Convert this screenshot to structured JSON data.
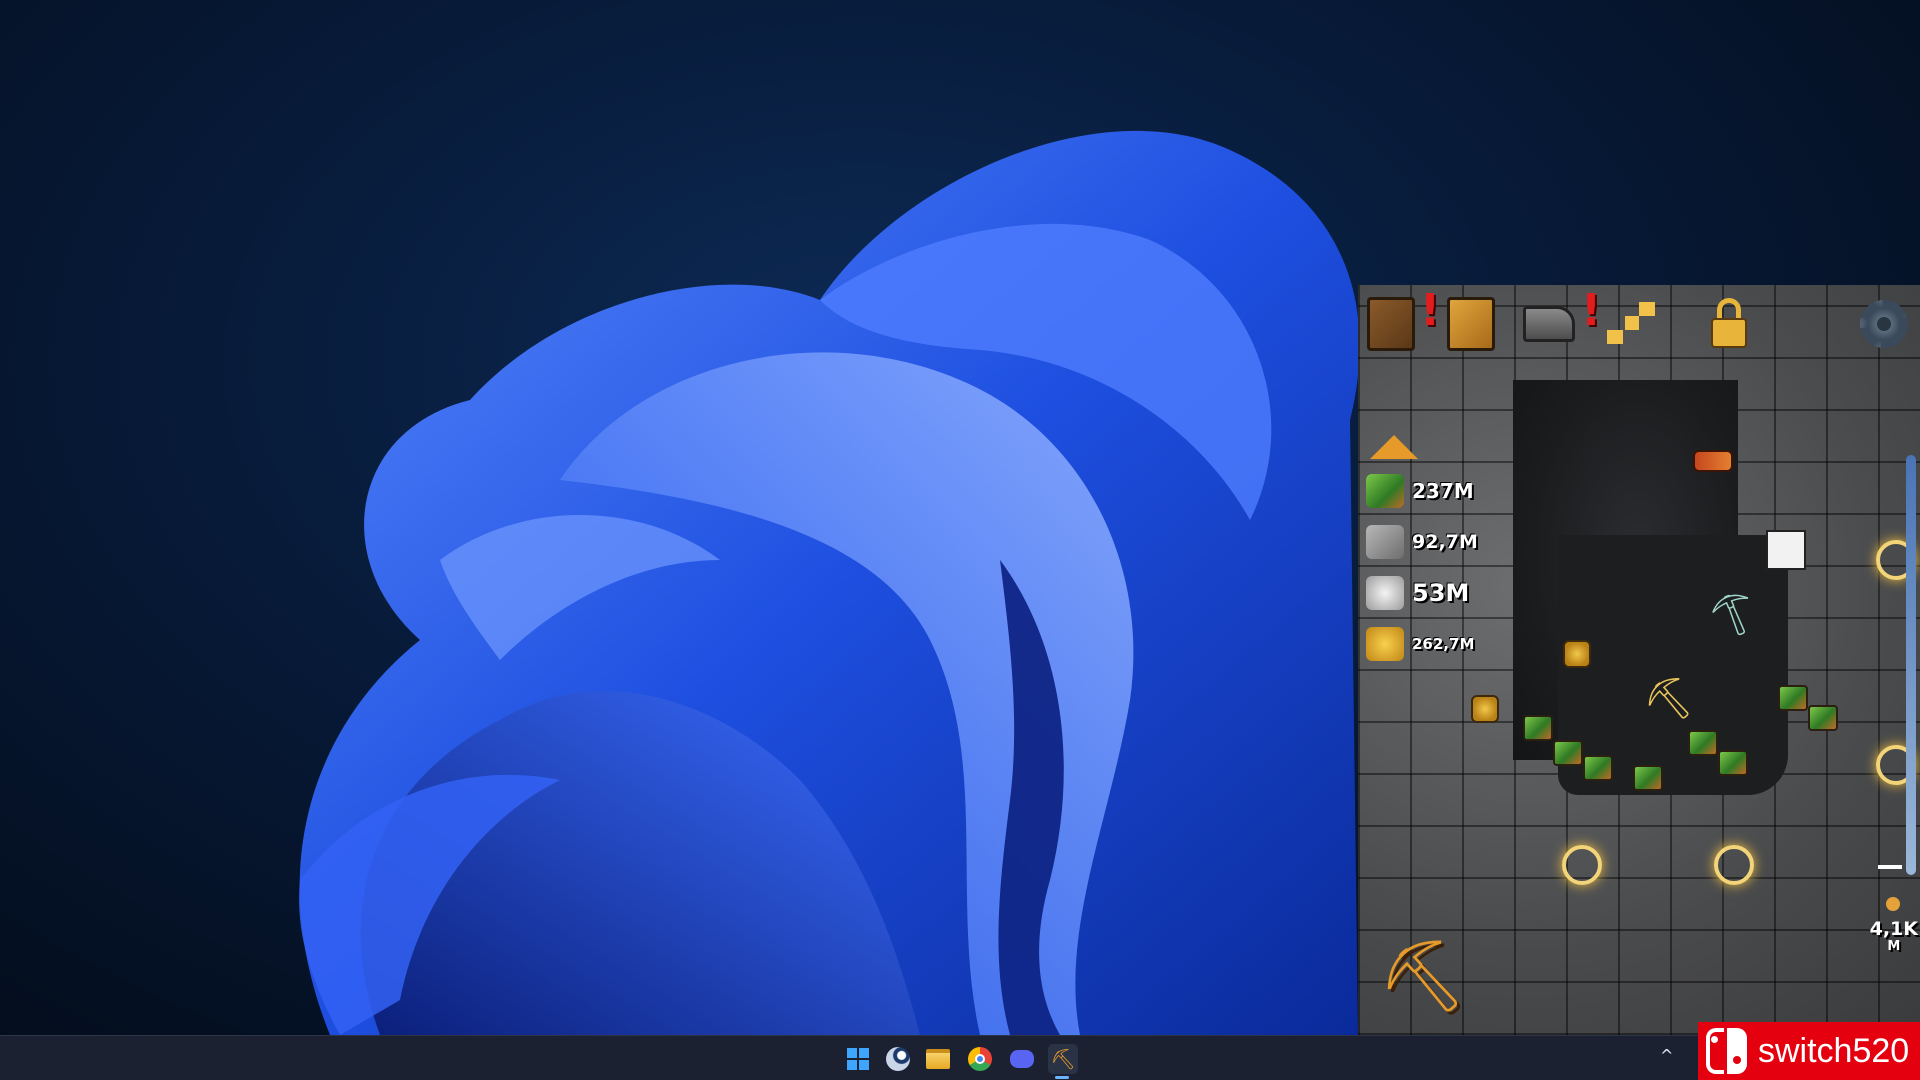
{
  "desktop": {
    "wallpaper": "windows-11-bloom",
    "accent": "#1f5cff"
  },
  "game": {
    "resources": [
      {
        "name": "emerald-ore",
        "value": "237M"
      },
      {
        "name": "stone",
        "value": "92,7M"
      },
      {
        "name": "iron",
        "value": "53M"
      },
      {
        "name": "gold",
        "value": "262,7M"
      }
    ],
    "depth": {
      "value": "4,1K",
      "unit": "M"
    },
    "top_icons": [
      "pickaxe-book-icon",
      "trophy-book-icon",
      "anvil-icon",
      "map-icon",
      "lock-icon",
      "settings-gear-icon"
    ]
  },
  "taskbar": {
    "apps": [
      "start-icon",
      "steam-icon",
      "file-explorer-icon",
      "chrome-icon",
      "discord-icon",
      "mining-game-icon"
    ],
    "active_app": "mining-game-icon"
  },
  "watermark": {
    "text": "switch520",
    "color": "#e5000f"
  }
}
